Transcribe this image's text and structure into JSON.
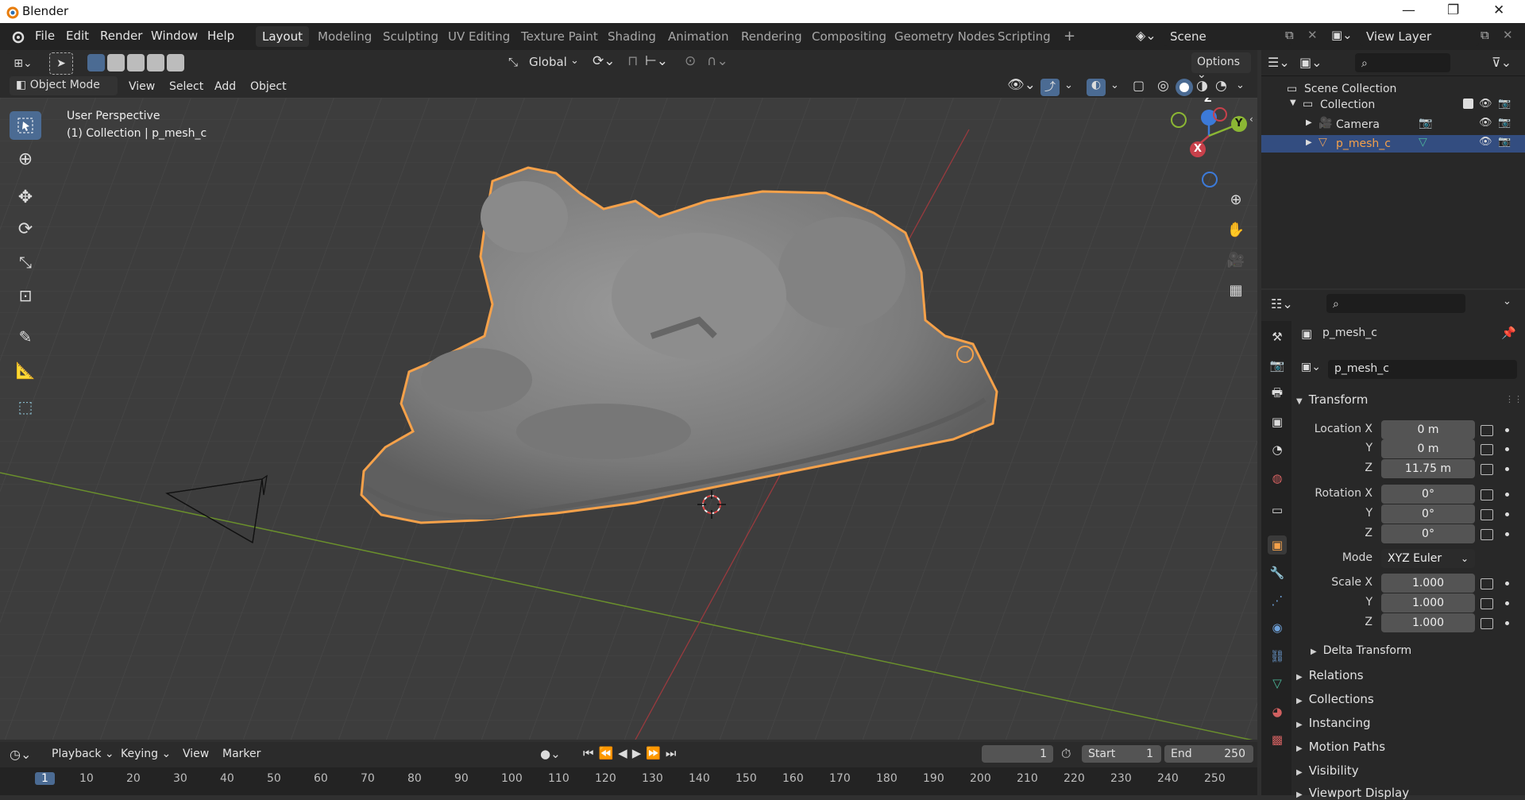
{
  "window": {
    "title": "Blender"
  },
  "menus": [
    "File",
    "Edit",
    "Render",
    "Window",
    "Help"
  ],
  "workspaces": [
    "Layout",
    "Modeling",
    "Sculpting",
    "UV Editing",
    "Texture Paint",
    "Shading",
    "Animation",
    "Rendering",
    "Compositing",
    "Geometry Nodes",
    "Scripting"
  ],
  "active_workspace": "Layout",
  "scene_name": "Scene",
  "view_layer": "View Layer",
  "viewport": {
    "orientation": "Global",
    "options_label": "Options",
    "mode": "Object Mode",
    "menus": [
      "View",
      "Select",
      "Add",
      "Object"
    ],
    "perspective_label": "User Perspective",
    "collection_label": "(1) Collection | p_mesh_c",
    "gizmo_axes": [
      "Z",
      "X",
      "Y"
    ]
  },
  "outliner": {
    "root": "Scene Collection",
    "items": [
      {
        "label": "Collection",
        "selected": false
      },
      {
        "label": "Camera",
        "selected": false
      },
      {
        "label": "p_mesh_c",
        "selected": true
      }
    ]
  },
  "properties": {
    "object_name": "p_mesh_c",
    "datablock_name": "p_mesh_c",
    "transform_title": "Transform",
    "location": {
      "label": "Location X",
      "x": "0 m",
      "y": "0 m",
      "z": "11.75 m"
    },
    "rotation": {
      "label": "Rotation X",
      "x": "0°",
      "y": "0°",
      "z": "0°"
    },
    "mode_label": "Mode",
    "mode_value": "XYZ Euler",
    "scale": {
      "label": "Scale X",
      "x": "1.000",
      "y": "1.000",
      "z": "1.000"
    },
    "axis_y": "Y",
    "axis_z": "Z",
    "delta_transform": "Delta Transform",
    "sections": [
      "Relations",
      "Collections",
      "Instancing",
      "Motion Paths",
      "Visibility",
      "Viewport Display"
    ]
  },
  "timeline": {
    "menus": [
      "Playback",
      "Keying",
      "View",
      "Marker"
    ],
    "current_frame": "1",
    "start_label": "Start",
    "start_value": "1",
    "end_label": "End",
    "end_value": "250",
    "ticks": [
      "1",
      "10",
      "20",
      "30",
      "40",
      "50",
      "60",
      "70",
      "80",
      "90",
      "100",
      "110",
      "120",
      "130",
      "140",
      "150",
      "160",
      "170",
      "180",
      "190",
      "200",
      "210",
      "220",
      "230",
      "240",
      "250"
    ]
  },
  "colors": {
    "selection_outline": "#f5a14a",
    "accent": "#4b6b93",
    "x_axis": "#c8414b",
    "y_axis": "#8bb634",
    "z_axis": "#3c7ad8"
  }
}
